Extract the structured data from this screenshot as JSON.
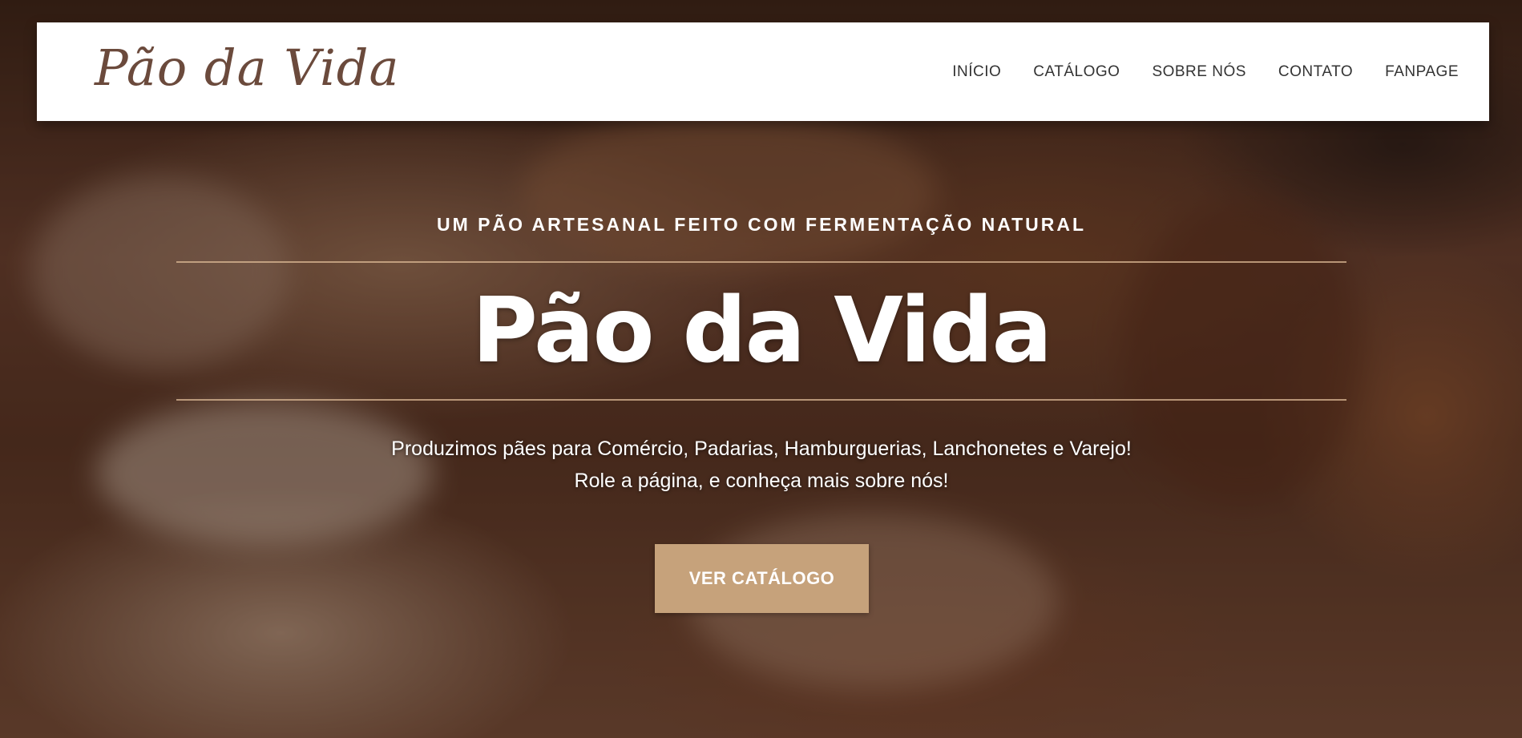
{
  "brand": {
    "logo_text": "Pão da Vida",
    "accent_color": "#c6a27b"
  },
  "nav": {
    "items": [
      {
        "label": "Início"
      },
      {
        "label": "Catálogo"
      },
      {
        "label": "Sobre nós"
      },
      {
        "label": "Contato"
      },
      {
        "label": "Fanpage"
      }
    ]
  },
  "hero": {
    "tagline": "UM PÃO ARTESANAL FEITO COM FERMENTAÇÃO NATURAL",
    "title": "Pão da Vida",
    "description_line1": "Produzimos pães para Comércio, Padarias, Hamburguerias, Lanchonetes e Varejo!",
    "description_line2": "Role a página, e conheça mais sobre nós!",
    "cta_label": "Ver Catálogo"
  }
}
